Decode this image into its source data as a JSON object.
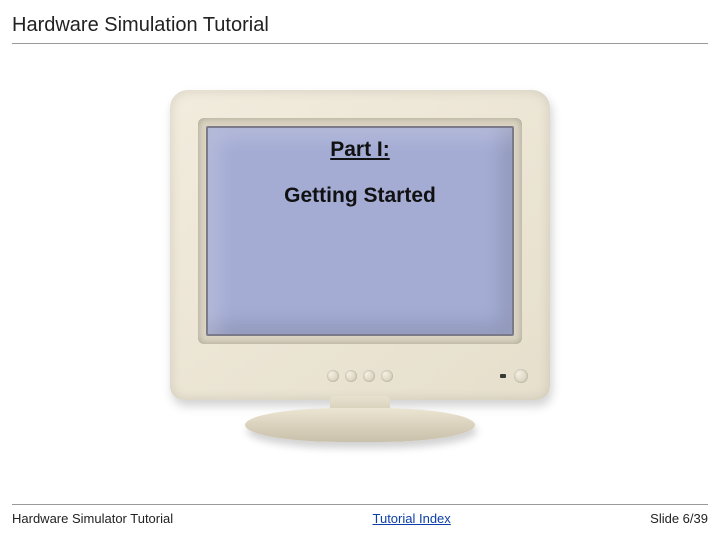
{
  "header": {
    "title": "Hardware Simulation Tutorial"
  },
  "screen": {
    "part_label": "Part I:",
    "subtitle": "Getting Started"
  },
  "footer": {
    "left": "Hardware Simulator Tutorial",
    "center": "Tutorial Index",
    "right": "Slide 6/39"
  }
}
